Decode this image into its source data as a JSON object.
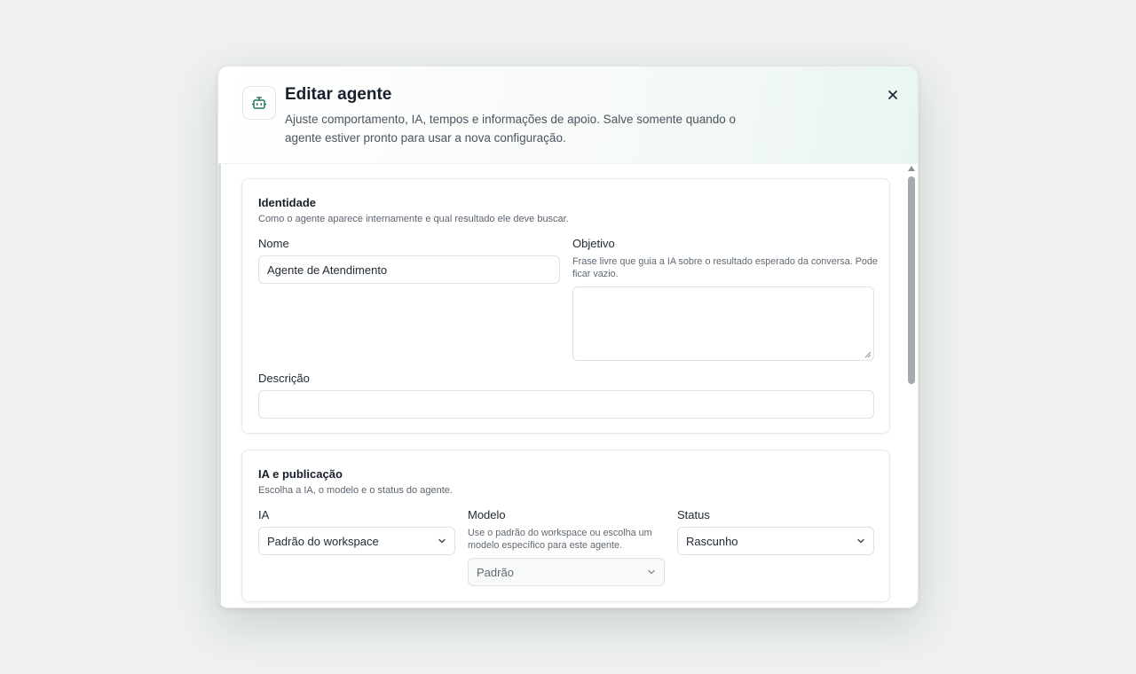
{
  "dialog": {
    "title": "Editar agente",
    "subtitle": "Ajuste comportamento, IA, tempos e informações de apoio. Salve somente quando o agente estiver pronto para usar a nova configuração.",
    "header_icon": "bot-icon",
    "close_icon": "close-icon",
    "accent_color": "#1f7a57"
  },
  "identity": {
    "title": "Identidade",
    "description": "Como o agente aparece internamente e qual resultado ele deve buscar.",
    "name_label": "Nome",
    "name_value": "Agente de Atendimento",
    "objective_label": "Objetivo",
    "objective_help": "Frase livre que guia a IA sobre o resultado esperado da conversa. Pode ficar vazio.",
    "objective_value": "",
    "description_label": "Descrição",
    "description_value": ""
  },
  "ai": {
    "title": "IA e publicação",
    "description": "Escolha a IA, o modelo e o status do agente.",
    "ia_label": "IA",
    "ia_value": "Padrão do workspace",
    "model_label": "Modelo",
    "model_help": "Use o padrão do workspace ou escolha um modelo específico para este agente.",
    "model_value": "Padrão",
    "status_label": "Status",
    "status_value": "Rascunho"
  }
}
